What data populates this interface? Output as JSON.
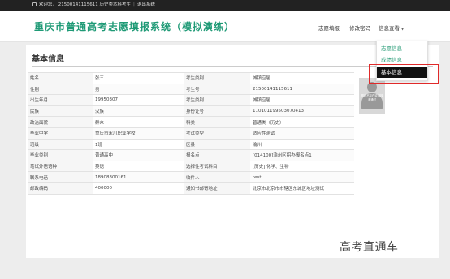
{
  "topbar": {
    "welcome": "欢迎您，",
    "user_info": "21500141115611 历史类本科考生",
    "logout": "退出系统"
  },
  "header": {
    "brand": "重庆市普通高考志愿填报系统（模拟演练）",
    "nav": [
      {
        "label": "志愿填报"
      },
      {
        "label": "修改密码"
      },
      {
        "label": "信息查看"
      }
    ],
    "dropdown": [
      {
        "label": "志愿信息"
      },
      {
        "label": "成绩信息"
      },
      {
        "label": "基本信息"
      }
    ]
  },
  "page": {
    "title": "基本信息"
  },
  "info_rows": [
    [
      "姓名",
      "张三",
      "考生类别",
      "城镇应届"
    ],
    [
      "性别",
      "男",
      "考生号",
      "21500141115611"
    ],
    [
      "出生年月",
      "19950307",
      "考生类别",
      "城镇应届"
    ],
    [
      "民族",
      "汉族",
      "身份证号",
      "110101199503070413"
    ],
    [
      "政治面貌",
      "群众",
      "科类",
      "普通类（历史）"
    ],
    [
      "毕业中学",
      "重庆市永川职业学校",
      "考试类型",
      "适应性测试"
    ],
    [
      "班级",
      "1班",
      "区县",
      "渝州"
    ],
    [
      "毕业类别",
      "普通高中",
      "报名点",
      "[014100]渝州区招办报名点1"
    ],
    [
      "笔试外语语种",
      "英语",
      "选择性考试科目",
      "[历史] 化学、生物"
    ],
    [
      "联系电话",
      "18908300161",
      "收件人",
      "test"
    ],
    [
      "邮政编码",
      "400000",
      "通知书邮寄地址",
      "北京市北京市市辖区东城区地址测试"
    ]
  ],
  "photo": {
    "placeholder": "照片不存在或审核未通过"
  },
  "watermark": "高考直通车",
  "colors": {
    "brand": "#1f9a76",
    "link": "#2a9d78",
    "highlight": "#e02a2a"
  }
}
